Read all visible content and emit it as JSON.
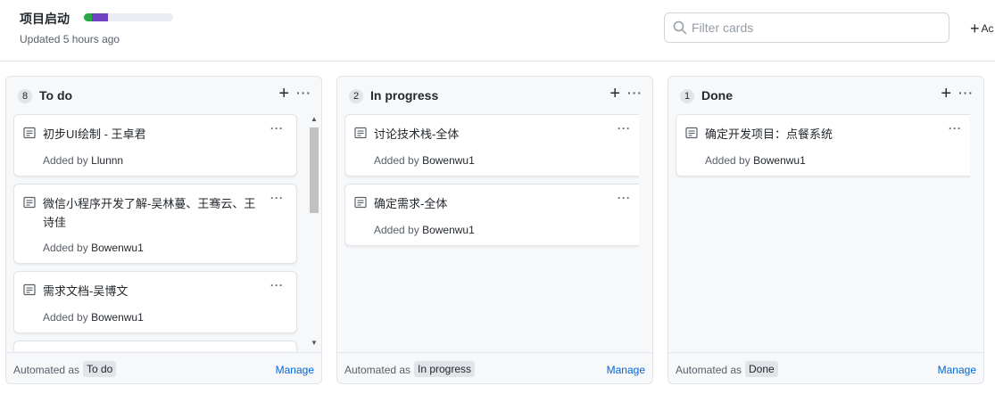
{
  "project": {
    "title": "项目启动",
    "updated": "Updated 5 hours ago",
    "progress": {
      "done_fraction": 0.09,
      "in_progress_fraction": 0.18,
      "todo_fraction": 0.73
    },
    "colors": {
      "done": "#28a745",
      "in_progress": "#6f42c1",
      "todo": "#e9ecf1"
    }
  },
  "filter": {
    "placeholder": "Filter cards",
    "value": "",
    "icon": "search-icon"
  },
  "add_column": {
    "label": "Ac"
  },
  "columns": [
    {
      "name": "To do",
      "count": "8",
      "automated_label": "Automated as",
      "automated_value": "To do",
      "manage": "Manage",
      "cards": [
        {
          "title": "初步UI绘制 - 王卓君",
          "added_prefix": "Added by",
          "user": "Llunnn"
        },
        {
          "title": "微信小程序开发了解-吴林蔓、王骞云、王诗佳",
          "added_prefix": "Added by",
          "user": "Bowenwu1"
        },
        {
          "title": "需求文档-吴博文",
          "added_prefix": "Added by",
          "user": "Bowenwu1"
        }
      ]
    },
    {
      "name": "In progress",
      "count": "2",
      "automated_label": "Automated as",
      "automated_value": "In progress",
      "manage": "Manage",
      "cards": [
        {
          "title": "讨论技术栈-全体",
          "added_prefix": "Added by",
          "user": "Bowenwu1"
        },
        {
          "title": "确定需求-全体",
          "added_prefix": "Added by",
          "user": "Bowenwu1"
        }
      ]
    },
    {
      "name": "Done",
      "count": "1",
      "automated_label": "Automated as",
      "automated_value": "Done",
      "manage": "Manage",
      "cards": [
        {
          "title": "确定开发项目：点餐系统",
          "added_prefix": "Added by",
          "user": "Bowenwu1"
        }
      ]
    }
  ]
}
